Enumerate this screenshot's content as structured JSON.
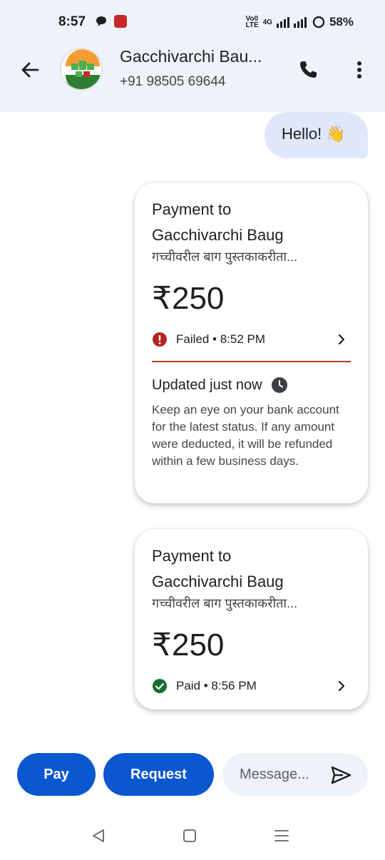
{
  "status_bar": {
    "time": "8:57",
    "network_top": "Vo0",
    "network_bottom": "LTE",
    "signal_label": "4G",
    "battery": "58%"
  },
  "header": {
    "contact_name": "Gacchivarchi Bau...",
    "phone": "+91 98505 69644",
    "icons": [
      "back-arrow-icon",
      "phone-icon",
      "more-vert-icon"
    ]
  },
  "messages": {
    "hello": "Hello! 👋"
  },
  "payments": [
    {
      "title_line1": "Payment to",
      "title_line2": "Gacchivarchi Baug",
      "description": "गच्चीवरील बाग पुस्तकाकरीता...",
      "amount": "₹250",
      "status": "Failed • 8:52 PM",
      "status_color": "#b3261e",
      "update_title": "Updated just now",
      "update_text": "Keep an eye on your bank account for the latest status. If any amount were deducted, it will be refunded within a few business days."
    },
    {
      "title_line1": "Payment to",
      "title_line2": "Gacchivarchi Baug",
      "description": "गच्चीवरील बाग पुस्तकाकरीता...",
      "amount": "₹250",
      "status": "Paid • 8:56 PM",
      "status_color": "#146c2e"
    }
  ],
  "composer": {
    "pay_label": "Pay",
    "request_label": "Request",
    "message_placeholder": "Message..."
  },
  "colors": {
    "accent": "#0b57d0",
    "header_bg": "#eef2f9",
    "bubble_bg": "#dfe7fb"
  }
}
